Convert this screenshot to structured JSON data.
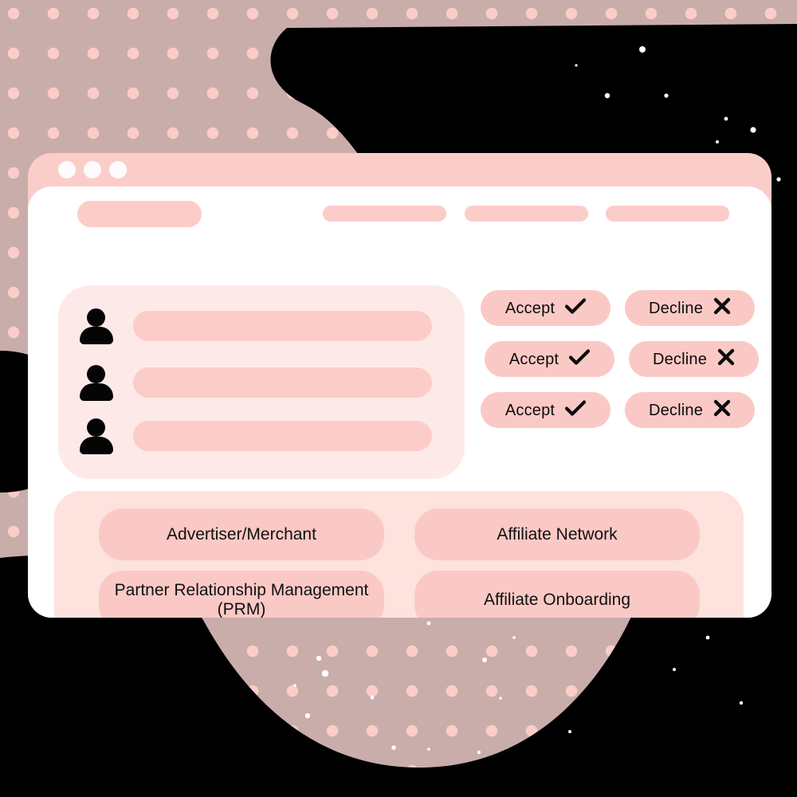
{
  "theme": {
    "backdrop": "#c9adab",
    "dot": "#fcccc8",
    "blob": "#000000",
    "window_frame": "#fbcdc9",
    "viewport": "#ffffff",
    "panel_soft": "#fdeae8",
    "pill": "#fbc9c5",
    "accent": "#fcccc9",
    "text": "#101010"
  },
  "window": {
    "traffic_lights": [
      {
        "name": "close"
      },
      {
        "name": "minimize"
      },
      {
        "name": "maximize"
      }
    ]
  },
  "navbar": {
    "logo_placeholder": "",
    "items": [
      {
        "label": ""
      },
      {
        "label": ""
      },
      {
        "label": ""
      }
    ]
  },
  "requests": {
    "rows": [
      {
        "avatar": "person-icon",
        "name_placeholder": ""
      },
      {
        "avatar": "person-icon",
        "name_placeholder": ""
      },
      {
        "avatar": "person-icon",
        "name_placeholder": ""
      }
    ]
  },
  "actions": {
    "accept_label": "Accept",
    "decline_label": "Decline",
    "accept_icon": "check-icon",
    "decline_icon": "close-x-icon",
    "rows": [
      {
        "accept": "Accept",
        "decline": "Decline"
      },
      {
        "accept": "Accept",
        "decline": "Decline"
      },
      {
        "accept": "Accept",
        "decline": "Decline"
      }
    ]
  },
  "categories": {
    "items": [
      {
        "label": "Advertiser/Merchant"
      },
      {
        "label": "Affiliate Network"
      },
      {
        "label": "Partner Relationship Management (PRM)"
      },
      {
        "label": "Affiliate Onboarding"
      }
    ]
  }
}
